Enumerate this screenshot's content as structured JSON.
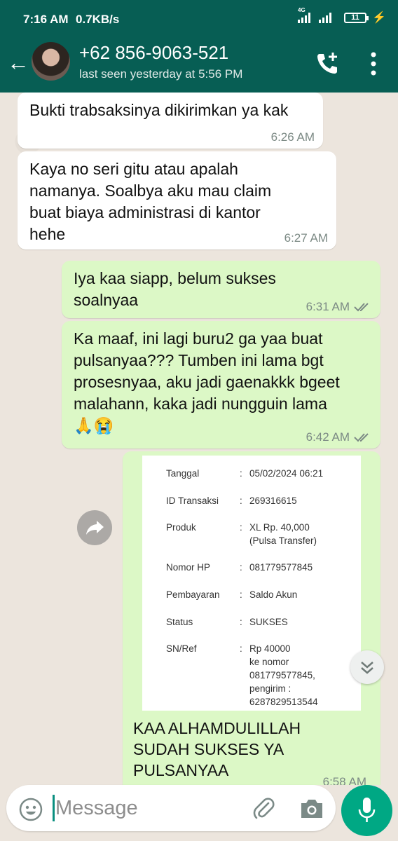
{
  "status_bar": {
    "time": "7:16 AM",
    "network_speed": "0.7KB/s",
    "network_type": "4G",
    "battery": "11"
  },
  "header": {
    "contact_name": "+62 856-9063-521",
    "last_seen": "last seen yesterday at 5:56 PM"
  },
  "messages": [
    {
      "dir": "in",
      "text": "Bukti trabsaksinya dikirimkan ya kak",
      "time": "6:26 AM"
    },
    {
      "dir": "in",
      "text": "Kaya no seri gitu atau apalah\nnamanya. Soalbya aku mau claim\nbuat biaya administrasi di kantor\nhehe",
      "time": "6:27 AM"
    },
    {
      "dir": "out",
      "text": "Iya kaa siapp, belum sukses\nsoalnyaa",
      "time": "6:31 AM"
    },
    {
      "dir": "out",
      "text": "Ka maaf, ini lagi buru2 ga yaa buat\npulsanyaa??? Tumben ini lama bgt\nprosesnyaa, aku jadi gaenakkk bgeet\nmalahann, kaka jadi nungguin lama\n🙏😭",
      "time": "6:42 AM"
    },
    {
      "dir": "out",
      "text": "KAA ALHAMDULILLAH\nSUDAH SUKSES YA\nPULSANYAA",
      "time": "6:58 AM"
    }
  ],
  "receipt": {
    "rows": [
      {
        "label": "Tanggal",
        "value": "05/02/2024 06:21"
      },
      {
        "label": "ID Transaksi",
        "value": "269316615"
      },
      {
        "label": "Produk",
        "value": "XL Rp. 40,000\n(Pulsa Transfer)"
      },
      {
        "label": "Nomor HP",
        "value": "081779577845"
      },
      {
        "label": "Pembayaran",
        "value": "Saldo Akun"
      },
      {
        "label": "Status",
        "value": "SUKSES"
      },
      {
        "label": "SN/Ref",
        "value": "Rp 40000\nke nomor\n081779577845,\npengirim :\n6287829513544"
      }
    ]
  },
  "input": {
    "placeholder": "Message"
  },
  "colors": {
    "header": "#075e54",
    "outgoing": "#dcf8c6",
    "incoming": "#ffffff",
    "accent": "#00a884",
    "read_tick": "#7c8a85"
  },
  "icons": [
    "back-arrow-icon",
    "add-call-icon",
    "overflow-menu-icon",
    "forward-icon",
    "chevron-double-down-icon",
    "emoji-icon",
    "attach-icon",
    "camera-icon",
    "mic-icon"
  ]
}
